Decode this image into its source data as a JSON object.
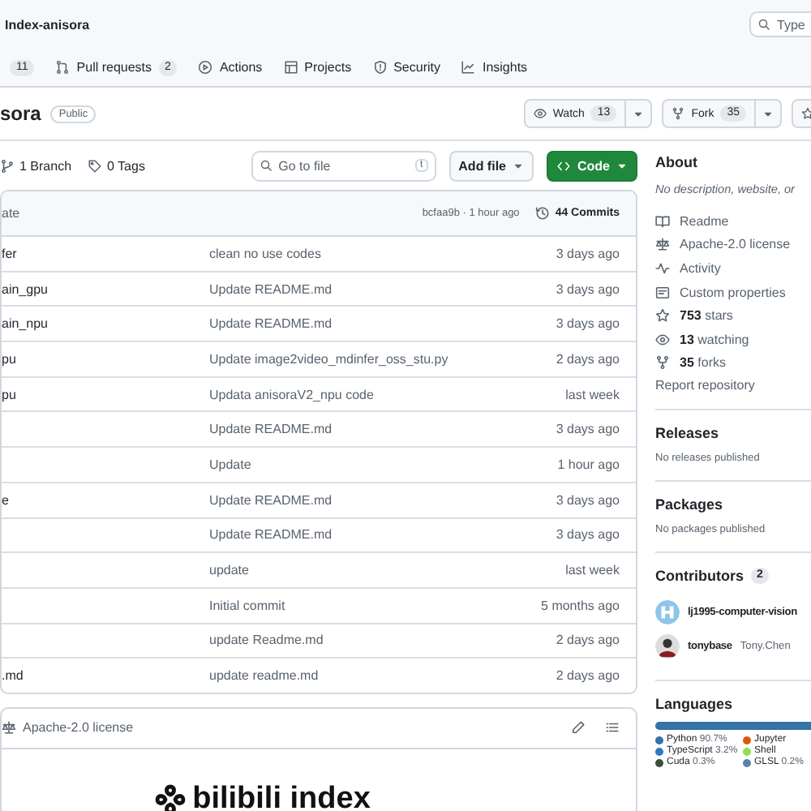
{
  "header": {
    "repo_name": "Index-anisora",
    "search": {
      "placeholder": "Type"
    }
  },
  "nav_tabs": [
    {
      "count": "11"
    },
    {
      "label": "Pull requests",
      "count": "2"
    },
    {
      "label": "Actions"
    },
    {
      "label": "Projects"
    },
    {
      "label": "Security"
    },
    {
      "label": "Insights"
    }
  ],
  "repo": {
    "name": "sora",
    "visibility": "Public",
    "watch": {
      "label": "Watch",
      "count": "13"
    },
    "fork": {
      "label": "Fork",
      "count": "35"
    }
  },
  "branch_bar": {
    "branches": "1 Branch",
    "tags": "0 Tags",
    "go_to_file": {
      "placeholder": "Go to file",
      "shortcut": "t"
    },
    "add_file": "Add file",
    "code": "Code"
  },
  "files": {
    "header": {
      "column_1": "ate",
      "commit": "bcfaa9b · 1 hour ago",
      "commits": "44 Commits"
    },
    "rows": [
      {
        "name": "fer",
        "message": "clean no use codes",
        "date": "3 days ago"
      },
      {
        "name": "ain_gpu",
        "message": "Update README.md",
        "date": "3 days ago"
      },
      {
        "name": "ain_npu",
        "message": "Update README.md",
        "date": "3 days ago"
      },
      {
        "name": "pu",
        "message": "Update image2video_mdinfer_oss_stu.py",
        "date": "2 days ago"
      },
      {
        "name": "pu",
        "message": "Updata anisoraV2_npu code",
        "date": "last week"
      },
      {
        "message": "Update README.md",
        "date": "3 days ago"
      },
      {
        "message": "Update",
        "date": "1 hour ago"
      },
      {
        "name": "e",
        "message": "Update README.md",
        "date": "3 days ago"
      },
      {
        "message": "Update README.md",
        "date": "3 days ago"
      },
      {
        "message": "update",
        "date": "last week"
      },
      {
        "message": "Initial commit",
        "date": "5 months ago"
      },
      {
        "message": "update Readme.md",
        "date": "2 days ago"
      },
      {
        "name": ".md",
        "message": "update readme.md",
        "date": "2 days ago"
      }
    ]
  },
  "readme": {
    "title": "Apache-2.0 license",
    "logo_text": "bilibili index"
  },
  "about": {
    "title": "About",
    "description": "No description, website, or",
    "links": [
      {
        "label": "Readme"
      },
      {
        "label": "Apache-2.0 license"
      },
      {
        "label": "Activity"
      },
      {
        "label": "Custom properties"
      },
      {
        "count": "753",
        "label": "stars"
      },
      {
        "count": "13",
        "label": "watching"
      },
      {
        "count": "35",
        "label": "forks"
      }
    ],
    "report": "Report repository"
  },
  "releases": {
    "title": "Releases",
    "note": "No releases published"
  },
  "packages": {
    "title": "Packages",
    "note": "No packages published"
  },
  "contributors": {
    "title": "Contributors",
    "count": "2",
    "people": [
      {
        "login": "lj1995-computer-vision"
      },
      {
        "login": "tonybase",
        "name": "Tony.Chen"
      }
    ]
  },
  "languages": {
    "title": "Languages",
    "items": [
      {
        "name": "Python",
        "percent": "90.7%",
        "color": "#3572a5"
      },
      {
        "name": "Jupyter",
        "color": "#da5b0b"
      },
      {
        "name": "TypeScript",
        "percent": "3.2%",
        "color": "#3178c6"
      },
      {
        "name": "Shell",
        "color": "#89e051"
      },
      {
        "name": "Cuda",
        "percent": "0.3%",
        "color": "#3a4e3a"
      },
      {
        "name": "GLSL",
        "percent": "0.2%",
        "color": "#5686a5"
      }
    ]
  }
}
